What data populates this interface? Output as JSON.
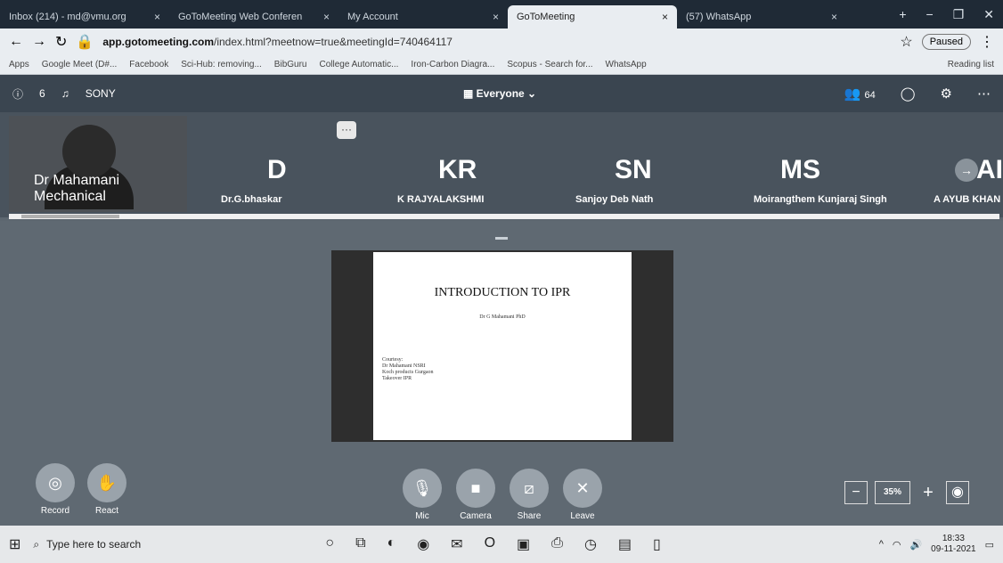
{
  "browser": {
    "tabs": [
      {
        "label": "Inbox (214) - md@vmu.org"
      },
      {
        "label": "GoToMeeting Web Conferen"
      },
      {
        "label": "My Account"
      },
      {
        "label": "GoToMeeting"
      },
      {
        "label": "(57) WhatsApp"
      }
    ],
    "url_domain": "app.gotomeeting.com",
    "url_path": "/index.html?meetnow=true&meetingId=740464117",
    "paused_label": "Paused",
    "bookmarks": [
      "Apps",
      "Google Meet (D#...",
      "Facebook",
      "Sci-Hub: removing...",
      "BibGuru",
      "College Automatic...",
      "Iron-Carbon Diagra...",
      "Scopus - Search for...",
      "WhatsApp"
    ],
    "reading_list": "Reading list"
  },
  "meeting": {
    "device": "SONY",
    "small_count": "6",
    "view_label": "Everyone",
    "participants_count": "64",
    "participants": [
      {
        "initials": "",
        "name": "Dr Mahamani Mechanical"
      },
      {
        "initials": "D",
        "name": "Dr.G.bhaskar"
      },
      {
        "initials": "KR",
        "name": "K RAJYALAKSHMI"
      },
      {
        "initials": "SN",
        "name": "Sanjoy Deb Nath"
      },
      {
        "initials": "MS",
        "name": "Moirangthem Kunjaraj Singh"
      },
      {
        "initials": "AI",
        "name": "A AYUB KHAN"
      }
    ],
    "slide": {
      "title": "INTRODUCTION TO IPR",
      "author": "Dr G Mahamani PhD",
      "credits": [
        "Courtesy:",
        "Dr Mahamani NSRI",
        "Koch products Gurgaon",
        "Takeover IPR"
      ]
    },
    "controls": {
      "record": "Record",
      "react": "React",
      "mic": "Mic",
      "camera": "Camera",
      "share": "Share",
      "leave": "Leave"
    },
    "zoom_value": "35%"
  },
  "taskbar": {
    "search_placeholder": "Type here to search",
    "time": "18:33",
    "date": "09-11-2021"
  }
}
